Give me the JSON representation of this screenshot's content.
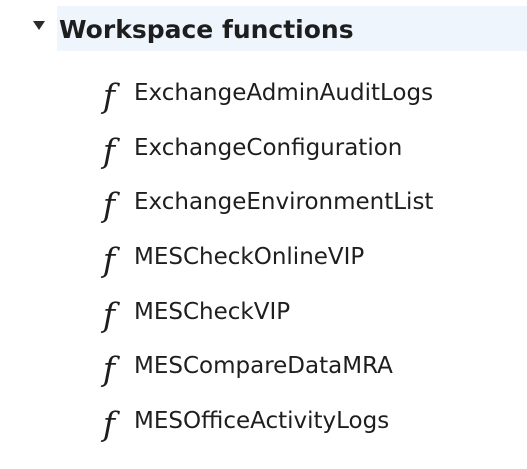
{
  "group": {
    "title": "Workspace functions",
    "expanded": true,
    "icon": "caret-down-icon",
    "highlight_color": "#eef5fd"
  },
  "functions": [
    {
      "icon": "function-icon",
      "glyph": "f",
      "label": "ExchangeAdminAuditLogs"
    },
    {
      "icon": "function-icon",
      "glyph": "f",
      "label": "ExchangeConfiguration"
    },
    {
      "icon": "function-icon",
      "glyph": "f",
      "label": "ExchangeEnvironmentList"
    },
    {
      "icon": "function-icon",
      "glyph": "f",
      "label": "MESCheckOnlineVIP"
    },
    {
      "icon": "function-icon",
      "glyph": "f",
      "label": "MESCheckVIP"
    },
    {
      "icon": "function-icon",
      "glyph": "f",
      "label": "MESCompareDataMRA"
    },
    {
      "icon": "function-icon",
      "glyph": "f",
      "label": "MESOfficeActivityLogs"
    }
  ]
}
